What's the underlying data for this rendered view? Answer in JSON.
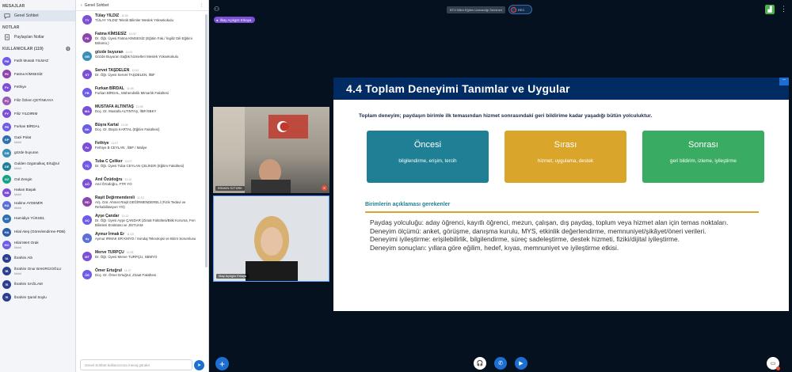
{
  "left": {
    "section_messages": "MESAJLAR",
    "public_chat": "Genel Sohbet",
    "section_notes": "NOTLAR",
    "shared_notes": "Paylaşılan Notlar",
    "users_header": "KULLANICILAR (119)",
    "users": [
      {
        "initials": "FM",
        "name": "Fatih Musab YILMAZ",
        "status": "",
        "color": "#6c5ce7",
        "mic": false
      },
      {
        "initials": "FK",
        "name": "Fatma KİMSESİZ",
        "status": "",
        "color": "#8e44ad",
        "mic": true
      },
      {
        "initials": "Fe",
        "name": "Fethiye",
        "status": "",
        "color": "#7b4fd6",
        "mic": false
      },
      {
        "initials": "FÇ",
        "name": "Filiz Özlem ÇETİNKAYA",
        "status": "",
        "color": "#9b59b6",
        "mic": false
      },
      {
        "initials": "FY",
        "name": "Filiz YILDIRIM",
        "status": "",
        "color": "#7b4fd6",
        "mic": true
      },
      {
        "initials": "FB",
        "name": "Furkan BİRDAL",
        "status": "",
        "color": "#6c5ce7",
        "mic": false
      },
      {
        "initials": "GP",
        "name": "Gazi Polat",
        "status": "Mobil",
        "color": "#2d6fb0",
        "mic": false
      },
      {
        "initials": "GB",
        "name": "gözde buyuran",
        "status": "",
        "color": "#3a8fb7",
        "mic": false
      },
      {
        "initials": "GE",
        "name": "Gulden özgünalkaç Ertuğrul",
        "status": "Mobil",
        "color": "#1f7f94",
        "mic": false
      },
      {
        "initials": "GZ",
        "name": "Gül Zengin",
        "status": "",
        "color": "#16a085",
        "mic": false
      },
      {
        "initials": "HB",
        "name": "Hakan Başak",
        "status": "Mobil",
        "color": "#7b4fd6",
        "mic": false
      },
      {
        "initials": "HA",
        "name": "Halime AYDEMİR",
        "status": "Mobil",
        "color": "#5b6fd6",
        "mic": false
      },
      {
        "initials": "HY",
        "name": "Hamidiye YÜKSEL",
        "status": "",
        "color": "#2d6fb0",
        "mic": false
      },
      {
        "initials": "HA",
        "name": "Hilal Ateş (Görevlendirme-PDB)",
        "status": "",
        "color": "#2b5ea7",
        "mic": false
      },
      {
        "initials": "HO",
        "name": "Hilal Mert Orak",
        "status": "Mobil",
        "color": "#6c5ce7",
        "mic": false
      },
      {
        "initials": "İA",
        "name": "İbrahim Atlı",
        "status": "",
        "color": "#2b3f8f",
        "mic": false
      },
      {
        "initials": "İB",
        "name": "İbrahim Onur BAKIRCIOĞLU",
        "status": "Mobil",
        "color": "#2b3f8f",
        "mic": false
      },
      {
        "initials": "İS",
        "name": "İbrahim SAĞLAM",
        "status": "",
        "color": "#2b3f8f",
        "mic": false
      },
      {
        "initials": "İS",
        "name": "İbrahim Şamil Soylu",
        "status": "",
        "color": "#2b3f8f",
        "mic": false
      }
    ]
  },
  "chat": {
    "title": "Genel Sohbet",
    "input_placeholder": "Genel Sohbet kullanıcısına mesaj gönder",
    "messages": [
      {
        "initials": "TY",
        "name": "Tülay YILDIZ",
        "time": "11:00",
        "text": "TÜLAY YILDIZ Teknik Bilimler Meslek Yüksekokulu",
        "color": "#7b4fd6"
      },
      {
        "initials": "FK",
        "name": "Fatma KİMSESİZ",
        "time": "11:00",
        "text": "Dr. Öğr. Üyesi Fatma KİMSESİZ (Eğitim Fak./ İngiliz Dili Eğitimi Bölümü.)",
        "color": "#8e44ad"
      },
      {
        "initials": "GB",
        "name": "gözde buyuran",
        "time": "11:03",
        "text": "Gözde Buyuran Sağlık hizmetleri Meslek Yüksekokulu",
        "color": "#3a8fb7"
      },
      {
        "initials": "ST",
        "name": "Servet TAŞDELEN",
        "time": "11:04",
        "text": "Dr. Öğr. Üyesi Servet TAŞDELEN, İİBF",
        "color": "#7b4fd6"
      },
      {
        "initials": "FB",
        "name": "Furkan BİRDAL",
        "time": "11:05",
        "text": "Furkan BİRDAL, Mühendislik Mimarlık Fakültesi",
        "color": "#6c5ce7"
      },
      {
        "initials": "MA",
        "name": "MUSTAFA ALTINTAŞ",
        "time": "11:05",
        "text": "Doç. Dr. Mustafa ALTINTAŞ, İİBF/SBKY",
        "color": "#7b4fd6"
      },
      {
        "initials": "BK",
        "name": "Büşra Kartal",
        "time": "11:06",
        "text": "Doç. Dr. Büşra KARTAL (Eğitim Fakültesi)",
        "color": "#6c5ce7"
      },
      {
        "initials": "Fe",
        "name": "Fethiye",
        "time": "11:07",
        "text": "Fethiye B CEYLAN , İİBF / Maliye",
        "color": "#7b4fd6"
      },
      {
        "initials": "TÇ",
        "name": "Tuba C Çeliker",
        "time": "11:07",
        "text": "Dr. Öğr. Üyesi Tuba CEYLAN ÇELİKER (Eğitim Fakültesi)",
        "color": "#6c5ce7"
      },
      {
        "initials": "AÖ",
        "name": "Anıl Özüdoğru",
        "time": "11:12",
        "text": "Anıl Özüdoğru, FTR YO",
        "color": "#7b4fd6"
      },
      {
        "initials": "RD",
        "name": "Raşit Değirmendereli",
        "time": "11:13",
        "text": "Arş. Gör. Ahmet Raşit DEĞİRMENDERELİ (Fizik Tedavi ve Rehabilitasyon YO)",
        "color": "#8e44ad"
      },
      {
        "initials": "AÇ",
        "name": "Ayşe Çandar",
        "time": "11:13",
        "text": "Dr. Öğr. Üyesi Ayşe ÇANDAR (Ziraat Fakültesi/Bitki Koruma, Fen Bilimleri Enstitüsü ve JİSTUAM",
        "color": "#6c5ce7"
      },
      {
        "initials": "Ay",
        "name": "Aymur İrmak Er",
        "time": "11:19",
        "text": "Aymur IRMAK ER KMYO / Sondaj Teknolojisi ve Birim Sorumlusu",
        "color": "#5b6fd6"
      },
      {
        "initials": "MT",
        "name": "Merve TURPÇU",
        "time": "11:25",
        "text": "Dr. Öğr. Üyesi Merve TURPÇU, SBMYO",
        "color": "#7b4fd6"
      },
      {
        "initials": "ÖE",
        "name": "Ömer Ertuğrul",
        "time": "11:27",
        "text": "Doç. Dr. Ömer Ertuğrul, Ziraat Fakültesi",
        "color": "#6c5ce7"
      }
    ]
  },
  "main": {
    "presenter": "İlkay Açıkgöz Erkaya",
    "recording_label": "BTÜ Bilim Eğitim Uzmanlığı Semineri",
    "recording_time": "REC",
    "tile1_label": "ERAKIN ÖZTÜRK",
    "tile2_label": "İlkay Açıkgöz Erkaya"
  },
  "slide": {
    "title": "4.4 Toplam Deneyimi Tanımlar ve Uygular",
    "intro": "Toplam deneyim; paydaşın birimle ilk temasından hizmet sonrasındaki geri bildirime kadar yaşadığı bütün yolculuktur.",
    "boxes": [
      {
        "title": "Öncesi",
        "sub": "bilgilendirme, erişim, tercih"
      },
      {
        "title": "Sırası",
        "sub": "hizmet, uygulama, destek"
      },
      {
        "title": "Sonrası",
        "sub": "geri bildirim, izleme, iyileştirme"
      }
    ],
    "section_title": "Birimlerin açıklaması gerekenler",
    "bullets": [
      "Paydaş yolculuğu: aday öğrenci, kayıtlı öğrenci, mezun, çalışan, dış paydaş, toplum veya hizmet alan için temas noktaları.",
      "Deneyim ölçümü: anket, görüşme, danışma kurulu, MYS, etkinlik değerlendirme, memnuniyet/şikâyet/öneri verileri.",
      "Deneyimi iyileştirme: erişilebilirlik, bilgilendirme, süreç sadeleştirme, destek hizmeti, fiziki/dijital iyileştirme.",
      "Deneyim sonuçları: yıllara göre eğilim, hedef, kıyas, memnuniyet ve iyileştirme etkisi."
    ]
  },
  "colors": {
    "accent": "#1c6fd1",
    "slide_header": "#002b63",
    "teal": "#1f7f94",
    "gold": "#d9a62b",
    "green": "#3aab62",
    "background": "#06111f"
  }
}
